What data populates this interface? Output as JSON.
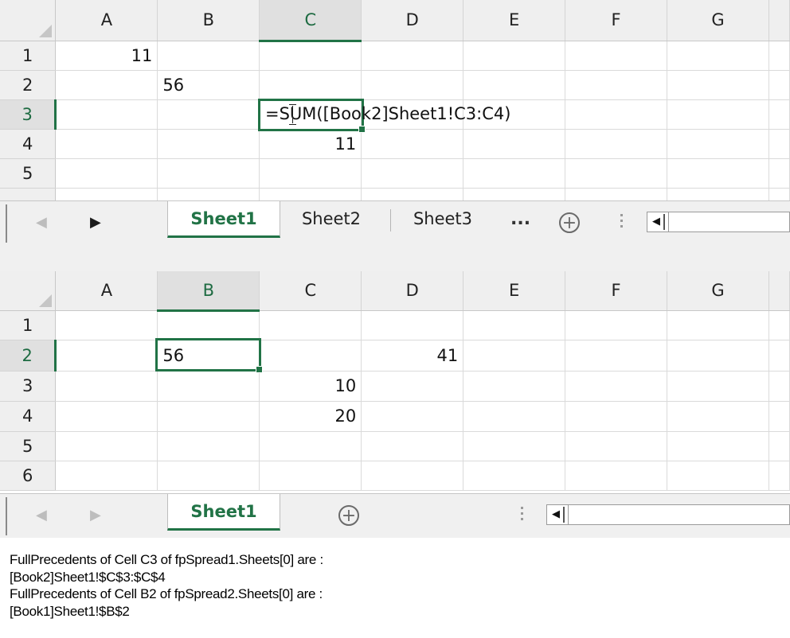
{
  "columns": [
    "A",
    "B",
    "C",
    "D",
    "E",
    "F",
    "G"
  ],
  "spread1": {
    "rows": [
      "1",
      "2",
      "3",
      "4",
      "5"
    ],
    "selected_column": "C",
    "selected_row": "3",
    "cells": {
      "A1": "11",
      "B2": "56",
      "C4": "11"
    },
    "editing_cell": "C3",
    "editing_formula": "=SUM([Book2]Sheet1!C3:C4)",
    "tabs": [
      "Sheet1",
      "Sheet2",
      "Sheet3"
    ],
    "active_tab": "Sheet1",
    "tab_overflow": "...",
    "add_sheet_symbol": "+"
  },
  "spread2": {
    "rows": [
      "1",
      "2",
      "3",
      "4",
      "5",
      "6"
    ],
    "selected_column": "B",
    "selected_row": "2",
    "cells": {
      "B2": "56",
      "D2": "41",
      "C3": "10",
      "C4": "20"
    },
    "tabs": [
      "Sheet1"
    ],
    "active_tab": "Sheet1",
    "add_sheet_symbol": "+"
  },
  "output_lines": [
    "FullPrecedents of Cell C3 of fpSpread1.Sheets[0] are :",
    "[Book2]Sheet1!$C$3:$C$4",
    "FullPrecedents of Cell B2 of fpSpread2.Sheets[0] are :",
    "[Book1]Sheet1!$B$2"
  ],
  "colors": {
    "accent": "#217346",
    "header_bg": "#efefef",
    "tabbar_bg": "#f0f0f0"
  }
}
